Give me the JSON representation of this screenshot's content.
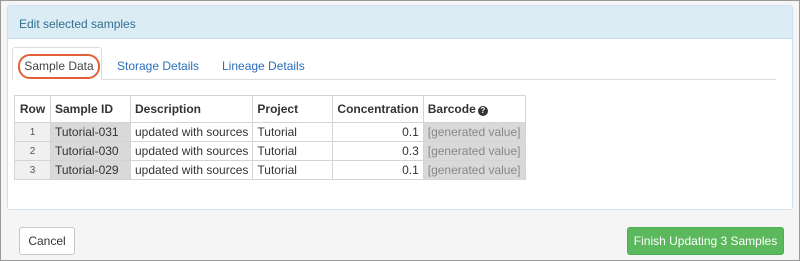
{
  "panel": {
    "title": "Edit selected samples"
  },
  "tabs": [
    {
      "label": "Sample Data",
      "active": true
    },
    {
      "label": "Storage Details",
      "active": false
    },
    {
      "label": "Lineage Details",
      "active": false
    }
  ],
  "grid": {
    "columns": [
      "Row",
      "Sample ID",
      "Description",
      "Project",
      "Concentration",
      "Barcode"
    ],
    "rows": [
      {
        "row": "1",
        "sample_id": "Tutorial-031",
        "description": "updated with sources",
        "project": "Tutorial",
        "concentration": "0.1",
        "barcode": "[generated value]"
      },
      {
        "row": "2",
        "sample_id": "Tutorial-030",
        "description": "updated with sources",
        "project": "Tutorial",
        "concentration": "0.3",
        "barcode": "[generated value]"
      },
      {
        "row": "3",
        "sample_id": "Tutorial-029",
        "description": "updated with sources",
        "project": "Tutorial",
        "concentration": "0.1",
        "barcode": "[generated value]"
      }
    ]
  },
  "buttons": {
    "cancel": "Cancel",
    "finish": "Finish Updating 3 Samples"
  },
  "icons": {
    "barcode_help": "help-icon"
  },
  "colors": {
    "accent_green": "#5cb85c",
    "heading_blue": "#31708f",
    "tab_highlight": "#e1603a"
  }
}
